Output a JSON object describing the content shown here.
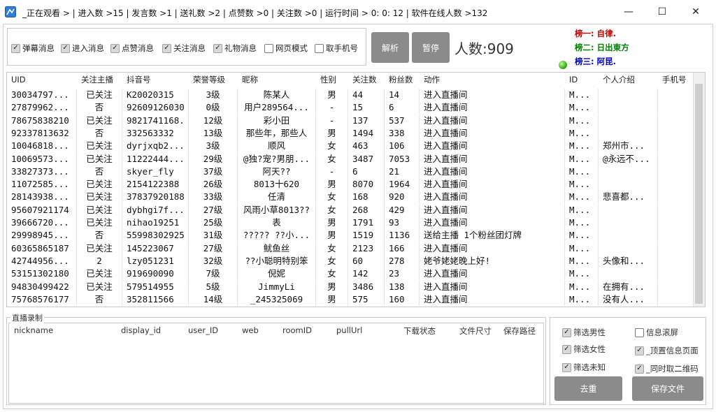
{
  "window": {
    "title": "_正在观看 > | 进入数 >15 | 发言数 >1 | 送礼数 >2 | 点赞数 >0 | 关注数 >0 | 运行时间 > 0: 0: 12 | 软件在线人数 >132",
    "minimize": "—",
    "maximize": "☐",
    "close": "✕"
  },
  "options": [
    {
      "label": "弹幕消息",
      "checked": true
    },
    {
      "label": "进入消息",
      "checked": true
    },
    {
      "label": "点赞消息",
      "checked": true
    },
    {
      "label": "关注消息",
      "checked": true
    },
    {
      "label": "礼物消息",
      "checked": true
    },
    {
      "label": "网页模式",
      "checked": false
    },
    {
      "label": "取手机号",
      "checked": false
    }
  ],
  "buttons": {
    "parse": "解析",
    "pause": "暂停",
    "dedup": "去重",
    "save": "保存文件"
  },
  "count_label": "人数:909",
  "ranks": [
    "榜一: 自律.",
    "榜二: 日出東方",
    "榜三: 阿昆."
  ],
  "table": {
    "columns": [
      "UID",
      "关注主播",
      "抖音号",
      "荣誉等级",
      "昵称",
      "性别",
      "关注数",
      "粉丝数",
      "动作",
      "ID",
      "个人介绍",
      "手机号"
    ],
    "rows": [
      [
        "30034797...",
        "已关注",
        "K20020315",
        "3级",
        "陈某人",
        "男",
        "44",
        "14",
        "进入直播间",
        "M...",
        "",
        ""
      ],
      [
        "27879962...",
        "否",
        "92609126030",
        "0级",
        "用户289564...",
        "-",
        "15",
        "6",
        "进入直播间",
        "M...",
        "",
        ""
      ],
      [
        "78675838210",
        "已关注",
        "9821741168.",
        "12级",
        "彩小田",
        "-",
        "137",
        "537",
        "进入直播间",
        "M...",
        "",
        ""
      ],
      [
        "92337813632",
        "否",
        "332563332",
        "13级",
        "那些年，那些人",
        "男",
        "1494",
        "338",
        "进入直播间",
        "M...",
        "",
        ""
      ],
      [
        "10046818...",
        "已关注",
        "dyrjxqb2...",
        "3级",
        "顺风",
        "女",
        "463",
        "106",
        "进入直播间",
        "M...",
        "郑州市...",
        ""
      ],
      [
        "10069573...",
        "已关注",
        "11222444...",
        "29级",
        "@独?宠?男朋...",
        "女",
        "3487",
        "7053",
        "进入直播间",
        "M...",
        "@永远不...",
        ""
      ],
      [
        "33827373...",
        "否",
        "skyer_fly",
        "37级",
        "阿天??",
        "-",
        "6",
        "21",
        "进入直播间",
        "M...",
        "",
        ""
      ],
      [
        "11072585...",
        "已关注",
        "2154122388",
        "26级",
        "8013十620",
        "男",
        "8070",
        "1964",
        "进入直播间",
        "M...",
        "",
        ""
      ],
      [
        "28143938...",
        "已关注",
        "37837920188",
        "33级",
        "任清",
        "女",
        "168",
        "920",
        "进入直播间",
        "M...",
        "悲喜都...",
        ""
      ],
      [
        "95607921174",
        "已关注",
        "dybhgi7f...",
        "27级",
        "风雨小草8013??",
        "女",
        "268",
        "429",
        "进入直播间",
        "M...",
        "",
        ""
      ],
      [
        "39666720...",
        "已关注",
        "nihao19251",
        "25级",
        "表",
        "男",
        "1791",
        "93",
        "进入直播间",
        "M...",
        "",
        ""
      ],
      [
        "29998945...",
        "否",
        "55998302925",
        "31级",
        "????? ??小...",
        "男",
        "1519",
        "1136",
        "送给主播 1个粉丝团灯牌",
        "M...",
        "",
        ""
      ],
      [
        "60365865187",
        "已关注",
        "145223067",
        "27级",
        "鱿鱼丝",
        "女",
        "2123",
        "166",
        "进入直播间",
        "M...",
        "",
        ""
      ],
      [
        "42744956...",
        "2",
        "lzy051231",
        "32级",
        "??小聪明特别笨",
        "女",
        "60",
        "278",
        "姥爷姥姥晚上好!",
        "M...",
        "头像和...",
        ""
      ],
      [
        "53151302180",
        "已关注",
        "919690090",
        "7级",
        "倪妮",
        "女",
        "142",
        "23",
        "进入直播间",
        "M...",
        "",
        ""
      ],
      [
        "94830499422",
        "已关注",
        "579514955",
        "5级",
        "JimmyLi",
        "男",
        "3486",
        "138",
        "进入直播间",
        "M...",
        "在拥有...",
        ""
      ],
      [
        "75768576177",
        "否",
        "352811566",
        "14级",
        "_245325069",
        "男",
        "575",
        "160",
        "进入直播间",
        "M...",
        "没有人...",
        ""
      ]
    ]
  },
  "recording": {
    "legend": "直播录制",
    "columns": [
      "nickname",
      "display_id",
      "user_ID",
      "web",
      "roomID",
      "pullUrl",
      "下载状态",
      "文件尺寸",
      "保存路径"
    ]
  },
  "filters": [
    {
      "label": "筛选男性",
      "checked": true
    },
    {
      "label": "信息滚屏",
      "checked": false
    },
    {
      "label": "筛选女性",
      "checked": true
    },
    {
      "label": "_顶置信息页面",
      "checked": true
    },
    {
      "label": "筛选未知",
      "checked": true
    },
    {
      "label": "_同时取二维码",
      "checked": true
    }
  ]
}
